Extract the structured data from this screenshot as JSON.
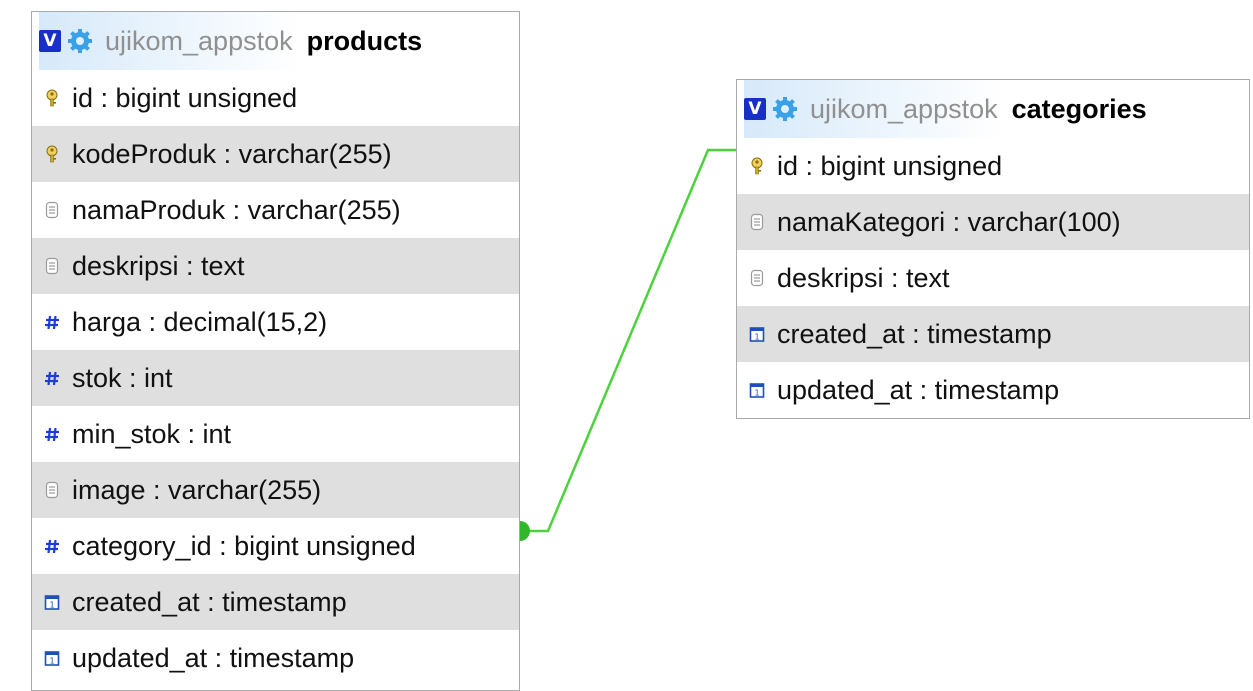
{
  "tables": {
    "products": {
      "badge": "V",
      "db": "ujikom_appstok",
      "name": "products",
      "columns": [
        {
          "text": "id : bigint unsigned",
          "icon": "key-icon"
        },
        {
          "text": "kodeProduk : varchar(255)",
          "icon": "key-icon"
        },
        {
          "text": "namaProduk : varchar(255)",
          "icon": "text-field-icon"
        },
        {
          "text": "deskripsi : text",
          "icon": "text-field-icon"
        },
        {
          "text": "harga : decimal(15,2)",
          "icon": "numeric-hash-icon"
        },
        {
          "text": "stok : int",
          "icon": "numeric-hash-icon"
        },
        {
          "text": "min_stok : int",
          "icon": "numeric-hash-icon"
        },
        {
          "text": "image : varchar(255)",
          "icon": "text-field-icon"
        },
        {
          "text": "category_id : bigint unsigned",
          "icon": "numeric-hash-icon"
        },
        {
          "text": "created_at : timestamp",
          "icon": "calendar-icon"
        },
        {
          "text": "updated_at : timestamp",
          "icon": "calendar-icon"
        }
      ]
    },
    "categories": {
      "badge": "V",
      "db": "ujikom_appstok",
      "name": "categories",
      "columns": [
        {
          "text": "id : bigint unsigned",
          "icon": "key-icon"
        },
        {
          "text": "namaKategori : varchar(100)",
          "icon": "text-field-icon"
        },
        {
          "text": "deskripsi : text",
          "icon": "text-field-icon"
        },
        {
          "text": "created_at : timestamp",
          "icon": "calendar-icon"
        },
        {
          "text": "updated_at : timestamp",
          "icon": "calendar-icon"
        }
      ]
    }
  },
  "colors": {
    "relation_line": "#4cd23c",
    "row_shade": "#dfdfdf",
    "badge": "#1830c8",
    "hash": "#1e3cd8"
  }
}
